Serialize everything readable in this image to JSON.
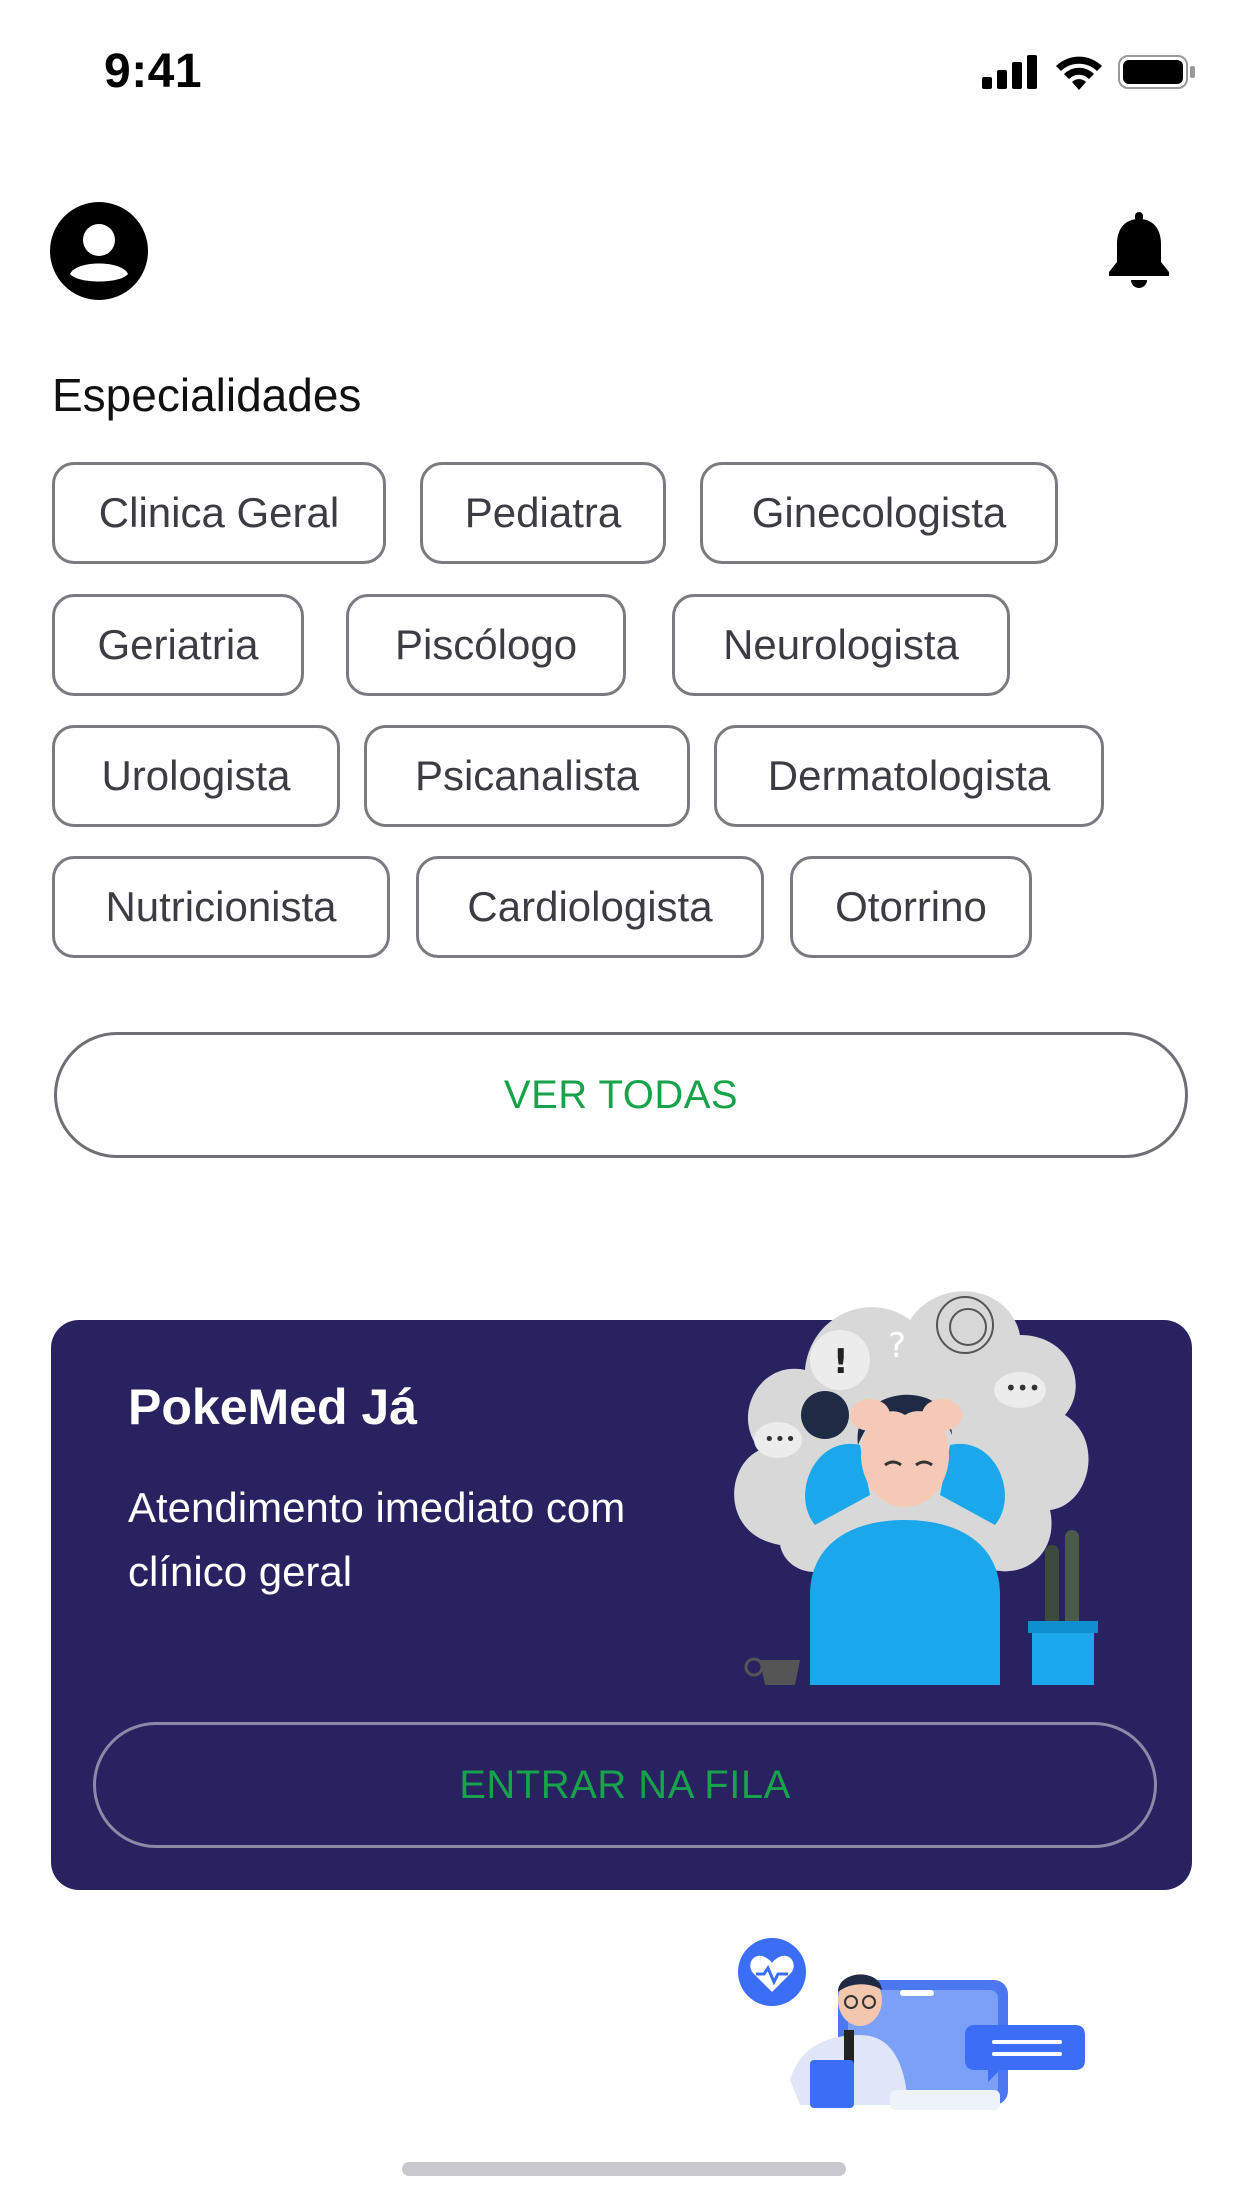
{
  "status_bar": {
    "time": "9:41"
  },
  "header": {
    "profile_icon": "account-circle-icon",
    "notifications_icon": "bell-icon"
  },
  "specialties": {
    "title": "Especialidades",
    "rows": [
      [
        "Clinica Geral",
        "Pediatra",
        "Ginecologista"
      ],
      [
        "Geriatria",
        "Piscólogo",
        "Neurologista"
      ],
      [
        "Urologista",
        "Psicanalista",
        "Dermatologista"
      ],
      [
        "Nutricionista",
        "Cardiologista",
        "Otorrino"
      ]
    ],
    "see_all_label": "VER TODAS"
  },
  "promo": {
    "title": "PokeMed Já",
    "description": "Atendimento imediato com clínico geral",
    "button_label": "ENTRAR NA FILA",
    "background_color": "#282260",
    "accent_color": "#16a34a"
  }
}
